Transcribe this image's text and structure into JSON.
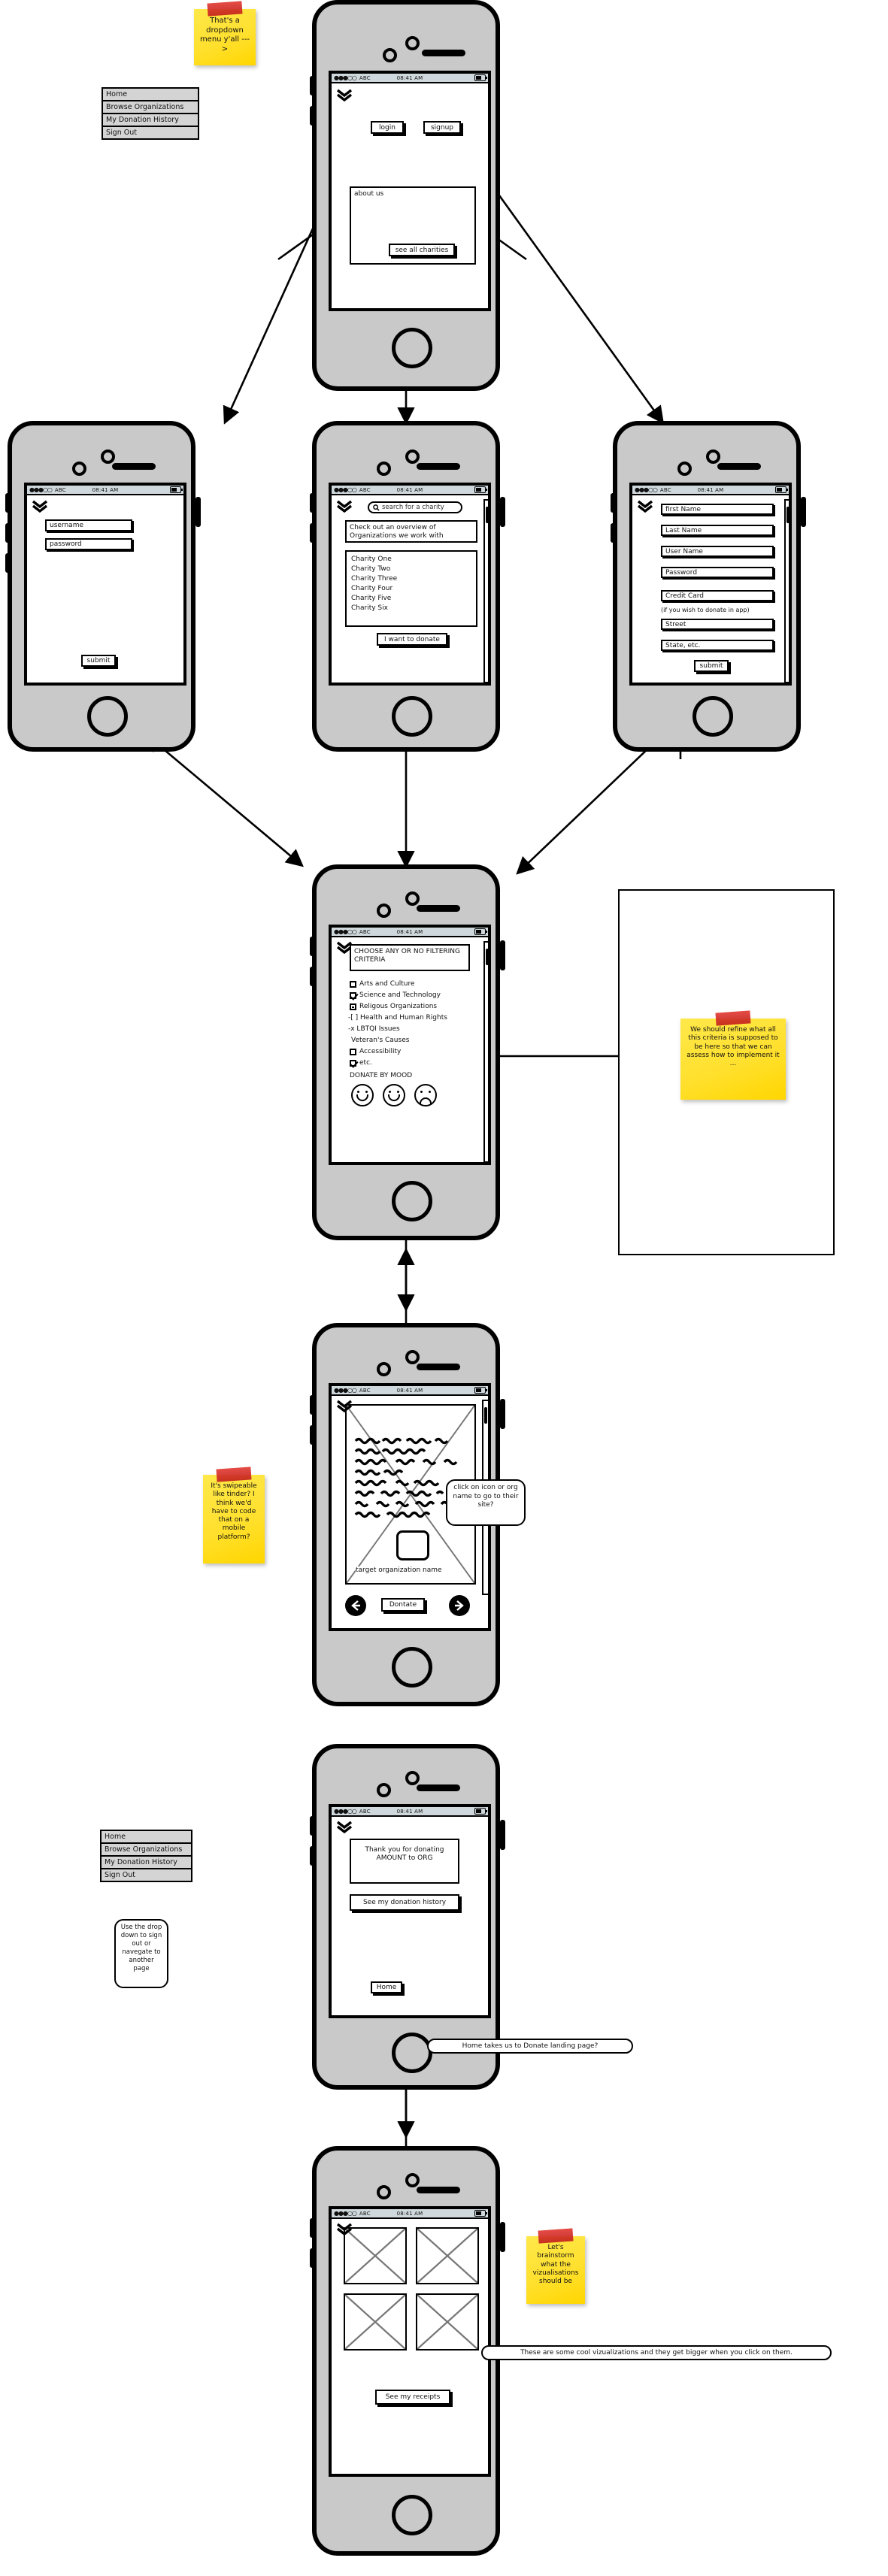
{
  "meta": {
    "title": "Charity Donation App — Wireframe Flow",
    "status_bar": {
      "dots": "●●●○○",
      "carrier": "ABC",
      "time": "08:41 AM"
    }
  },
  "notes": [
    {
      "id": "note-dropdown",
      "text": "That's a dropdown menu y'all --->"
    },
    {
      "id": "note-criteria",
      "text": "We should refine what all this criteria is supposed to be here so that we can assess how to implement it ..."
    },
    {
      "id": "note-swipe",
      "text": "It's swipeable like tinder? I think we'd have to code that on a mobile platform?"
    },
    {
      "id": "note-viz",
      "text": "Let's brainstorm what the vizualisations should be"
    }
  ],
  "dropdown": {
    "items": [
      "Home",
      "Browse Organizations",
      "My Donation History",
      "Sign Out"
    ]
  },
  "screens": {
    "landing": {
      "name": "landing-screen",
      "login_label": "login",
      "signup_label": "signup",
      "about_label": "about us",
      "see_all_label": "see all charities"
    },
    "login": {
      "name": "login-screen",
      "username_placeholder": "username",
      "password_placeholder": "password",
      "submit_label": "submit"
    },
    "browse": {
      "name": "browse-screen",
      "search_placeholder": "search for a charity",
      "overview_text": "Check out an overview of Organizations we work with",
      "charities": [
        "Charity One",
        "Charity Two",
        "Charity Three",
        "Charity Four",
        "Charity Five",
        "Charity Six"
      ],
      "donate_label": "I want to donate"
    },
    "signup": {
      "name": "signup-screen",
      "fields": [
        "first Name",
        "Last Name",
        "User Name",
        "Password",
        "Credit Card"
      ],
      "credit_note": "(if you wish to donate in app)",
      "address_fields": [
        "Street",
        "State, etc."
      ],
      "submit_label": "submit"
    },
    "filter": {
      "name": "filter-screen",
      "heading": "CHOOSE ANY OR NO FILTERING CRITERIA",
      "criteria": [
        {
          "label": "Arts and Culture",
          "state": "unchecked"
        },
        {
          "label": "Science and Technology",
          "state": "checked"
        },
        {
          "label": "Religous Organizations",
          "state": "dash"
        },
        {
          "label": "-[ ] Health and Human Rights",
          "state": "text"
        },
        {
          "label": "-x LBTQI Issues",
          "state": "text"
        },
        {
          "label": "Veteran's Causes",
          "state": "none"
        },
        {
          "label": "Accessibility",
          "state": "unchecked"
        },
        {
          "label": "etc.",
          "state": "checked"
        }
      ],
      "mood_heading": "DONATE BY MOOD",
      "moods": [
        "happy",
        "happy",
        "sad"
      ]
    },
    "org": {
      "name": "organization-detail-screen",
      "org_name_label": "target organization name",
      "donate_label": "Dontate",
      "callout": "click on icon or org name to go to their site?"
    },
    "thanks": {
      "name": "thank-you-screen",
      "thanks_text": "Thank you for donating AMOUNT to ORG",
      "history_label": "See my donation history",
      "home_label": "Home",
      "dropdown_callout": "Use the drop down to sign out or navegate to another page",
      "home_callout": "Home takes us to Donate landing page?"
    },
    "history": {
      "name": "donation-history-screen",
      "receipts_label": "See my receipts",
      "viz_callout": "These are some cool vizualizations and they get bigger when you click on them."
    }
  },
  "colors": {
    "sticky": "#ffe02e",
    "tape": "#d32a23",
    "ink": "#000000",
    "chrome": "#c9c9c9",
    "statusbar": "#cfd8dc"
  }
}
